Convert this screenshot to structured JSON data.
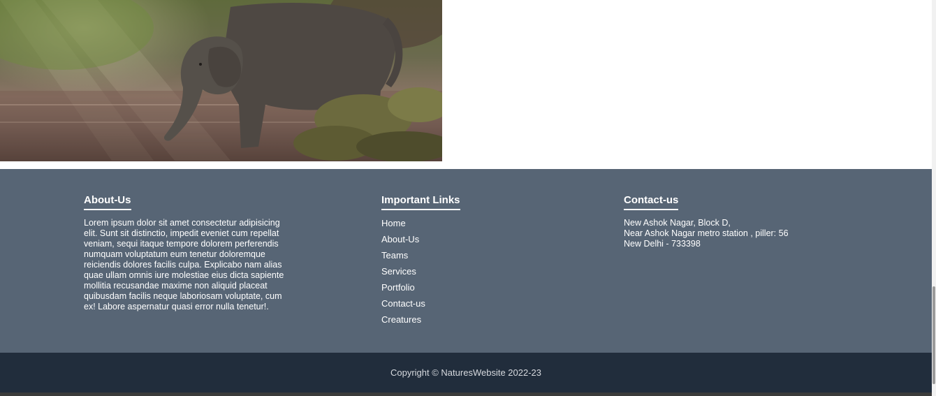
{
  "image": {
    "alt": "elephant"
  },
  "footer": {
    "about": {
      "heading": "About-Us",
      "text": "Lorem ipsum dolor sit amet consectetur adipisicing elit. Sunt sit distinctio, impedit eveniet cum repellat veniam, sequi itaque tempore dolorem perferendis numquam voluptatum eum tenetur doloremque reiciendis dolores facilis culpa. Explicabo nam alias quae ullam omnis iure molestiae eius dicta sapiente mollitia recusandae maxime non aliquid placeat quibusdam facilis neque laboriosam voluptate, cum ex! Labore aspernatur quasi error nulla tenetur!."
    },
    "links": {
      "heading": "Important Links",
      "items": [
        "Home",
        "About-Us",
        "Teams",
        "Services",
        "Portfolio",
        "Contact-us",
        "Creatures"
      ]
    },
    "contact": {
      "heading": "Contact-us",
      "lines": [
        "New Ashok Nagar, Block D,",
        "Near Ashok Nagar metro station , piller: 56",
        "New Delhi - 733398"
      ]
    }
  },
  "copyright": "Copyright © NaturesWebsite 2022-23",
  "colors": {
    "footer_bg": "#576575",
    "copyright_bg": "#212d3c",
    "text": "#ffffff"
  }
}
